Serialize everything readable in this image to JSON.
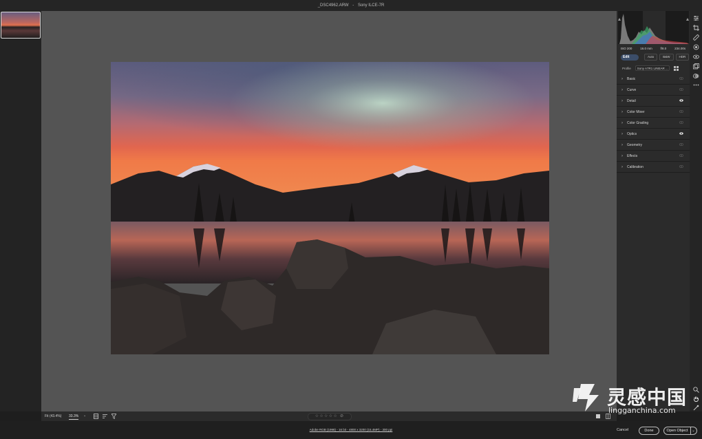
{
  "window": {
    "filename": "_DSC4962.ARW",
    "separator": "-",
    "camera": "Sony ILCE-7R"
  },
  "exif": {
    "iso": "ISO 200",
    "focal_length": "16.0 mm",
    "aperture": "f/8.0",
    "shutter": "234.00s"
  },
  "edit_panel": {
    "edit_tab": "Edit",
    "auto_button": "Auto",
    "bw_button": "B&W",
    "hdr_button": "HDR",
    "profile_label": "Profile",
    "profile_value": "Sony A7R1 LINEAR ...",
    "sections": [
      {
        "label": "Basic",
        "eye": "eye-icon"
      },
      {
        "label": "Curve",
        "eye": "eye-icon"
      },
      {
        "label": "Detail",
        "eye": "eye-icon"
      },
      {
        "label": "Color Mixer",
        "eye": "eye-icon"
      },
      {
        "label": "Color Grading",
        "eye": "eye-icon"
      },
      {
        "label": "Optics",
        "eye": "eye-icon"
      },
      {
        "label": "Geometry",
        "eye": "eye-icon"
      },
      {
        "label": "Effects",
        "eye": "eye-icon"
      },
      {
        "label": "Calibration",
        "eye": "eye-icon"
      }
    ]
  },
  "bottom_bar": {
    "fit_label": "Fit (43.4%)",
    "zoom_value": "33.3%",
    "zoom_chevron": "⌄",
    "rating": "☆☆☆☆☆ ⊘"
  },
  "footer": {
    "workflow_options": "Adobe RGB (1998) - 16 bit - 4800 x 3200 (15.4MP) - 300 ppi",
    "cancel_button": "Cancel",
    "done_button": "Done",
    "open_button": "Open Object",
    "open_menu": "⌄"
  },
  "watermark": {
    "chinese": "灵感中国",
    "url": "lingganchina.com"
  },
  "colors": {
    "accent": "#5a8cdc",
    "panel": "#2b2b2b",
    "canvas": "#545454"
  }
}
